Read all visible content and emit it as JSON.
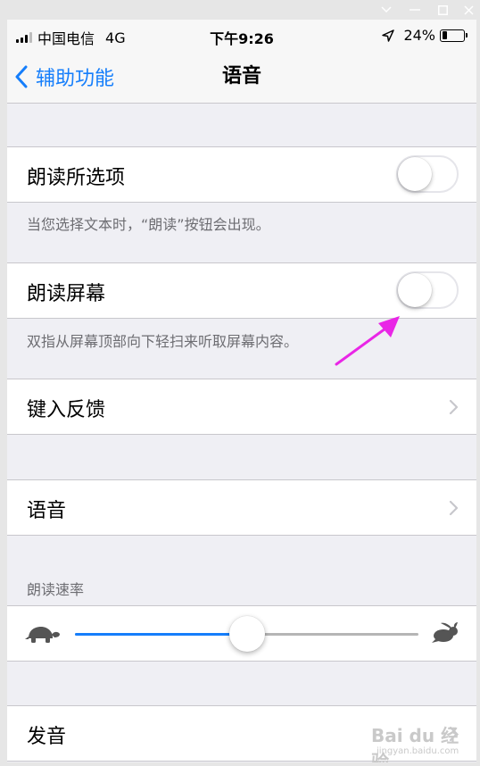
{
  "window": {
    "controls": [
      {
        "name": "collapse-icon",
        "glyph": "∨"
      },
      {
        "name": "minimize-icon",
        "glyph": "—"
      },
      {
        "name": "maximize-icon",
        "glyph": "☐"
      },
      {
        "name": "close-icon",
        "glyph": "✕"
      }
    ]
  },
  "status_bar": {
    "carrier": "中国电信",
    "network": "4G",
    "time": "下午9:26",
    "battery_percent_text": "24%",
    "battery_level": 0.24,
    "signal_bars_filled": 3,
    "signal_bars_total": 4
  },
  "nav": {
    "back_label": "辅助功能",
    "title": "语音"
  },
  "settings": {
    "speak_selection": {
      "label": "朗读所选项",
      "enabled": false,
      "footer": "当您选择文本时，“朗读”按钮会出现。"
    },
    "speak_screen": {
      "label": "朗读屏幕",
      "enabled": false,
      "footer": "双指从屏幕顶部向下轻扫来听取屏幕内容。"
    },
    "typing_feedback": {
      "label": "键入反馈"
    },
    "voices": {
      "label": "语音"
    },
    "speaking_rate": {
      "header": "朗读速率",
      "value": 0.5
    },
    "pronunciations": {
      "label": "发音"
    }
  },
  "watermark": {
    "main": "Bai du 经验",
    "sub": "jingyan.baidu.com"
  },
  "colors": {
    "accent": "#157efb",
    "background": "#efeff4",
    "annotation_arrow": "#e926e6",
    "secondary_text": "#6d6d72"
  },
  "icons": {
    "back": "chevron-left-icon",
    "disclosure": "chevron-right-icon",
    "slow": "turtle-icon",
    "fast": "hare-icon",
    "location": "location-arrow-icon"
  }
}
